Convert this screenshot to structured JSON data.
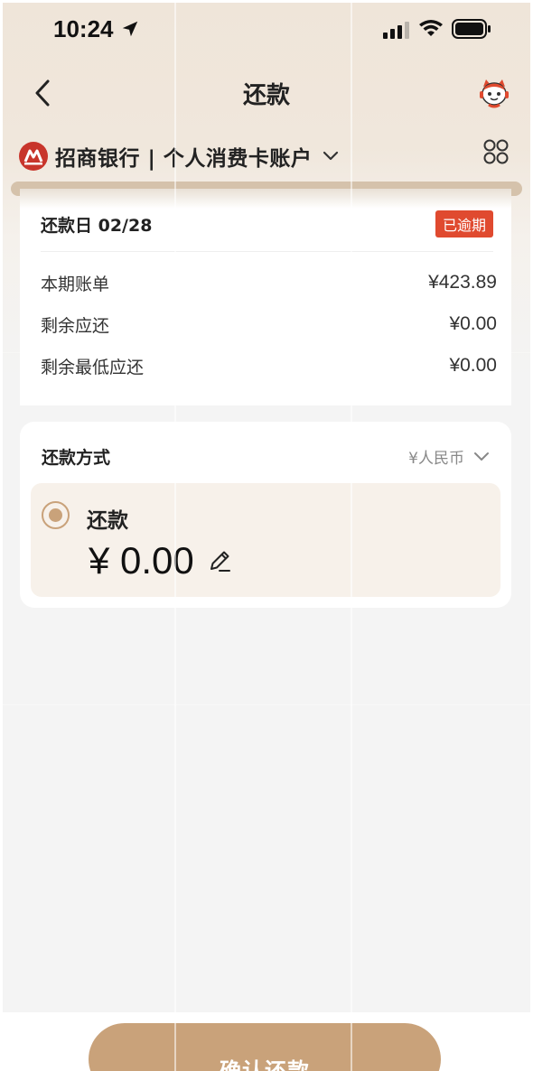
{
  "status_bar": {
    "time": "10:24"
  },
  "nav": {
    "title": "还款"
  },
  "account": {
    "name": "招商银行 | 个人消费卡账户"
  },
  "receipt": {
    "due_label": "还款日 02/28",
    "badge": "已逾期",
    "rows": [
      {
        "label": "本期账单",
        "value": "¥423.89"
      },
      {
        "label": "剩余应还",
        "value": "¥0.00"
      },
      {
        "label": "剩余最低应还",
        "value": "¥0.00"
      }
    ]
  },
  "payment": {
    "title": "还款方式",
    "currency": "¥人民币",
    "option_label": "还款",
    "amount": "¥ 0.00"
  },
  "footer": {
    "confirm_label": "确认还款"
  },
  "colors": {
    "accent": "#c9a27a",
    "badge": "#e04a2f",
    "bank_red": "#c8352b"
  }
}
